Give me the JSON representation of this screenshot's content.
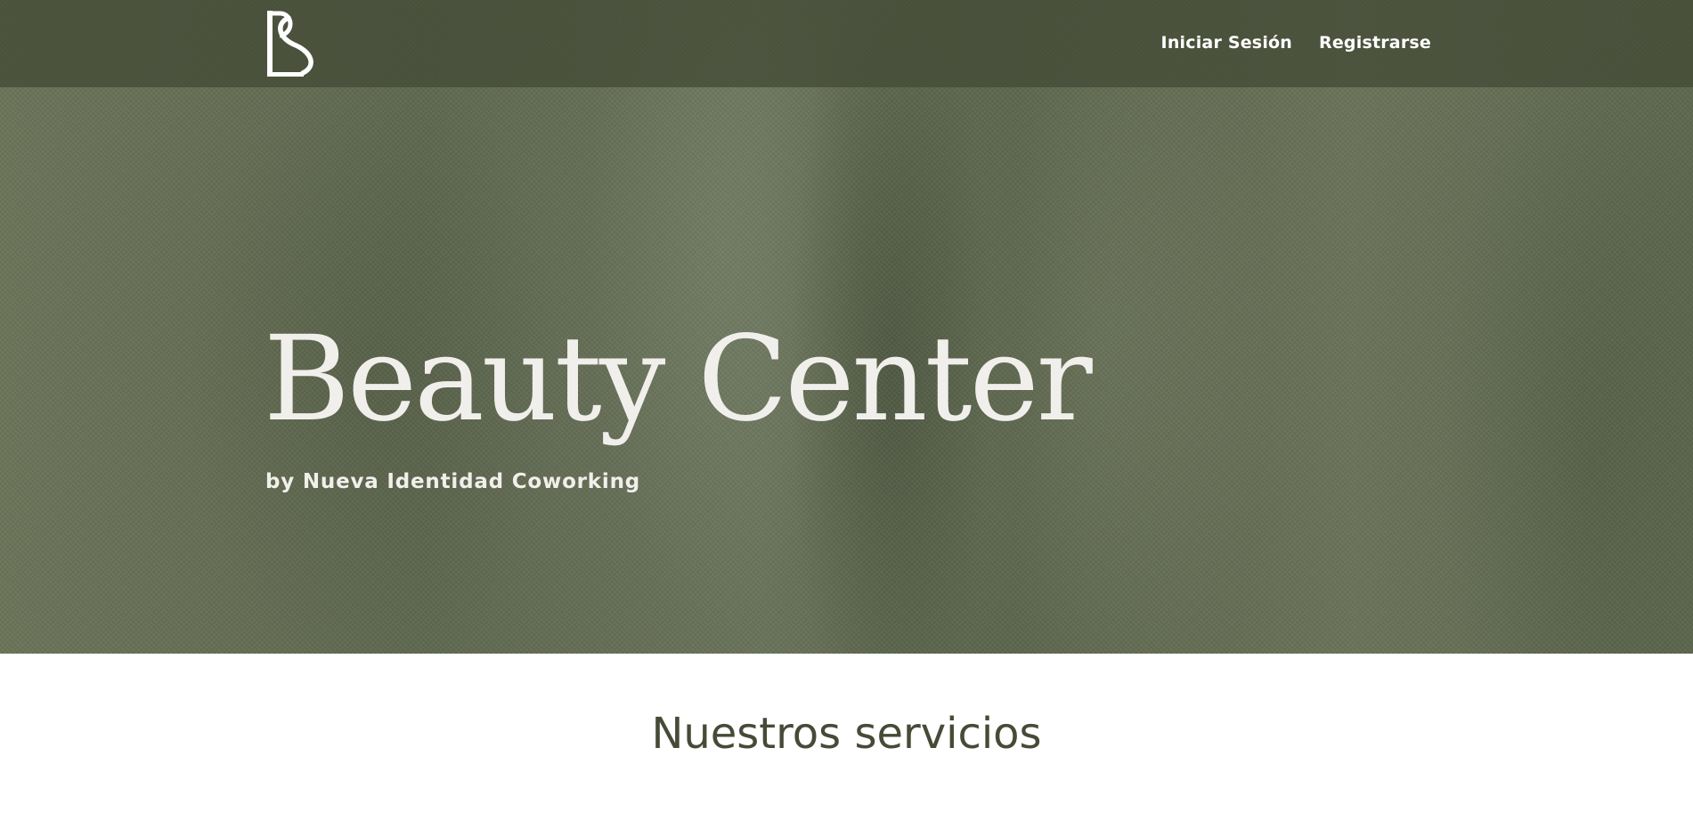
{
  "brand": {
    "logo_icon": "bs-monogram-logo",
    "logo_text": "BS"
  },
  "nav": {
    "items": [
      {
        "label": "Iniciar Sesión"
      },
      {
        "label": "Registrarse"
      }
    ]
  },
  "hero": {
    "title": "Beauty Center",
    "subtitle": "by Nueva Identidad Coworking"
  },
  "services": {
    "heading": "Nuestros servicios"
  },
  "colors": {
    "hero_green": "#636b53",
    "header_overlay": "#444a36",
    "hero_text": "#f1efeb",
    "heading_dark_green": "#454b36",
    "background": "#ffffff"
  }
}
